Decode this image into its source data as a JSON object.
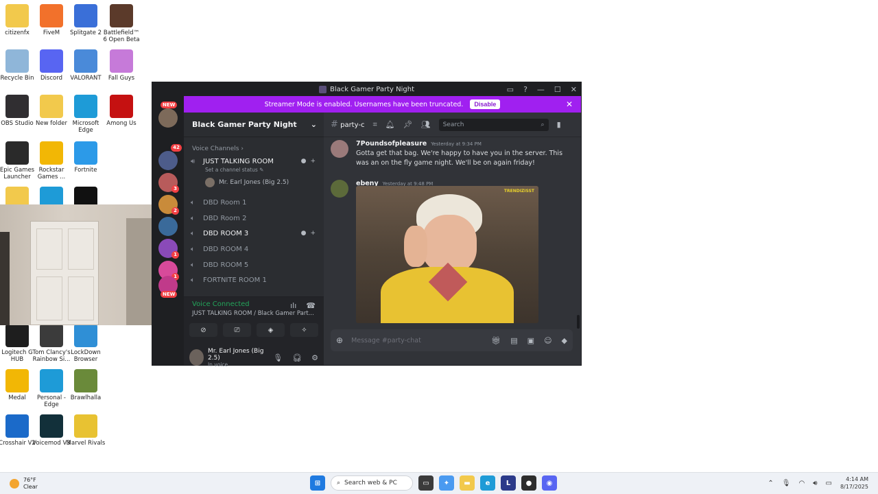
{
  "desktop": {
    "icons": [
      {
        "label": "citizenfx",
        "icon": "folder-icon",
        "color": "#f2c94c"
      },
      {
        "label": "FiveM",
        "icon": "fivem-icon",
        "color": "#f2712b"
      },
      {
        "label": "Splitgate 2",
        "icon": "splitgate-icon",
        "color": "#3a6fd8"
      },
      {
        "label": "Battlefield™ 6 Open Beta",
        "icon": "battlefield-icon",
        "color": "#5b3a2a"
      },
      {
        "label": "Recycle Bin",
        "icon": "recycle-bin-icon",
        "color": "#8fb6d9"
      },
      {
        "label": "Discord",
        "icon": "discord-icon",
        "color": "#5865f2"
      },
      {
        "label": "VALORANT",
        "icon": "valorant-icon",
        "color": "#4a8ad9"
      },
      {
        "label": "Fall Guys",
        "icon": "fall-guys-icon",
        "color": "#c67ad9"
      },
      {
        "label": "OBS Studio",
        "icon": "obs-icon",
        "color": "#302e31"
      },
      {
        "label": "New folder",
        "icon": "folder-icon",
        "color": "#f2c94c"
      },
      {
        "label": "Microsoft Edge",
        "icon": "edge-icon",
        "color": "#1e9bd7"
      },
      {
        "label": "Among Us",
        "icon": "among-us-icon",
        "color": "#c51111"
      },
      {
        "label": "Epic Games Launcher",
        "icon": "epic-icon",
        "color": "#2a2a2a"
      },
      {
        "label": "Rockstar Games ...",
        "icon": "rockstar-icon",
        "color": "#f2b705"
      },
      {
        "label": "Fortnite",
        "icon": "fortnite-icon",
        "color": "#2c9ae8"
      },
      {
        "label": "Logitech G HUB",
        "icon": "logitech-icon",
        "color": "#1e1e1e"
      },
      {
        "label": "Tom Clancy's Rainbow Si...",
        "icon": "rainbow-six-icon",
        "color": "#3b3b3b"
      },
      {
        "label": "LockDown Browser",
        "icon": "lockdown-icon",
        "color": "#2f8fd6"
      },
      {
        "label": "Medal",
        "icon": "medal-icon",
        "color": "#f2b705"
      },
      {
        "label": "Personal - Edge",
        "icon": "edge-icon",
        "color": "#1e9bd7"
      },
      {
        "label": "Brawlhalla",
        "icon": "brawlhalla-icon",
        "color": "#6a8a3a"
      },
      {
        "label": "Crosshair V2",
        "icon": "crosshair-icon",
        "color": "#1b6ac9"
      },
      {
        "label": "Voicemod V3",
        "icon": "voicemod-icon",
        "color": "#12303a"
      },
      {
        "label": "Marvel Rivals",
        "icon": "marvel-rivals-icon",
        "color": "#e8c232"
      },
      {
        "label": "",
        "icon": "folder-icon",
        "color": "#f2c94c"
      },
      {
        "label": "",
        "icon": "edge-icon",
        "color": "#1e9bd7"
      },
      {
        "label": "",
        "icon": "call-of-duty-icon",
        "color": "#111111"
      }
    ]
  },
  "discord": {
    "window_title": "Black Gamer Party Night",
    "streamer_banner": {
      "text": "Streamer Mode is enabled. Usernames have been truncated.",
      "button": "Disable"
    },
    "guild_badges": {
      "new_top": "NEW",
      "new_bottom": "NEW",
      "count_a": "42",
      "count_b": "1",
      "count_c": "3",
      "count_d": "2",
      "count_e": "1",
      "count_f": "1"
    },
    "server": {
      "name": "Black Gamer Party Night",
      "category": "Voice Channels",
      "channel_status_hint": "Set a channel status",
      "channels": [
        {
          "name": "JUST TALKING ROOM",
          "active": true
        },
        {
          "name": "DBD Room 1",
          "active": false
        },
        {
          "name": "DBD Room 2",
          "active": false
        },
        {
          "name": "DBD ROOM 3",
          "active": true
        },
        {
          "name": "DBD ROOM 4",
          "active": false
        },
        {
          "name": "DBD ROOM 5",
          "active": false
        },
        {
          "name": "FORTNITE ROOM 1",
          "active": false
        }
      ],
      "member_in_voice": "Mr. Earl Jones (Big 2.5)"
    },
    "voice": {
      "status": "Voice Connected",
      "location": "JUST TALKING ROOM / Black Gamer Part..."
    },
    "user": {
      "name": "Mr. Earl Jones (Big 2.5)",
      "status": "In voice"
    },
    "chat": {
      "channel": "party-c",
      "search_placeholder": "Search",
      "messages": [
        {
          "author": "7Poundsofpleasure",
          "time": "Yesterday at 9:34 PM",
          "text": "Gotta get that bag. We're happy to have you in the server. This was an on the fly game night. We'll be on again friday!"
        },
        {
          "author": "ebeny",
          "time": "Yesterday at 9:48 PM",
          "text": ""
        }
      ],
      "gif_watermark": "TRENDIZISST",
      "composer_placeholder": "Message #party-chat"
    }
  },
  "taskbar": {
    "weather_temp": "76°F",
    "weather_desc": "Clear",
    "search_placeholder": "Search web & PC",
    "time": "4:14 AM",
    "date": "8/17/2025"
  }
}
